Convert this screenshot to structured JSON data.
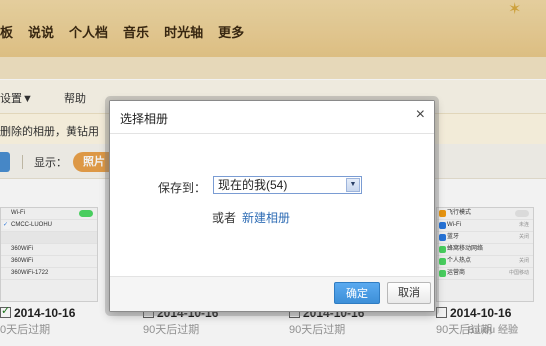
{
  "nav": {
    "items": [
      "板",
      "说说",
      "个人档",
      "音乐",
      "时光轴",
      "更多"
    ]
  },
  "toolbar": {
    "settings": "设置▼",
    "help": "帮助"
  },
  "notice": {
    "text": "删除的相册，黄钻用"
  },
  "controls": {
    "display_label": "显示：",
    "pill_label": "照片"
  },
  "photos": [
    {
      "date": "2014-10-16",
      "expire": "0天后过期",
      "checked": true
    },
    {
      "date": "2014-10-16",
      "expire": "90天后过期",
      "checked": false
    },
    {
      "date": "2014-10-16",
      "expire": "90天后过期",
      "checked": false
    },
    {
      "date": "2014-10-16",
      "expire": "90天后过期",
      "checked": false
    }
  ],
  "thumb1": {
    "rows": [
      "Wi-Fi",
      "CMCC-LUOHU",
      "",
      "360WiFi",
      "360WiFi",
      "360WiFi-1722"
    ]
  },
  "thumb4": {
    "rows": [
      "飞行模式",
      "Wi-Fi",
      "蓝牙",
      "蜂窝移动网络",
      "个人热点",
      "运营商"
    ],
    "right": [
      "",
      "未连",
      "关闭",
      "",
      "关闭",
      "中国移动"
    ]
  },
  "watermark": "Baidu 经验",
  "dialog": {
    "title": "选择相册",
    "close": "×",
    "save_label": "保存到：",
    "selected_album": "现在的我(54)",
    "or_text": "或者",
    "new_album_link": "新建相册",
    "confirm_label": "确定",
    "cancel_label": "取消"
  },
  "colors": {
    "banner": "#e8c98a",
    "confirm": "#3d8fd8",
    "link": "#2f6db5",
    "pill": "#e9a14a"
  }
}
